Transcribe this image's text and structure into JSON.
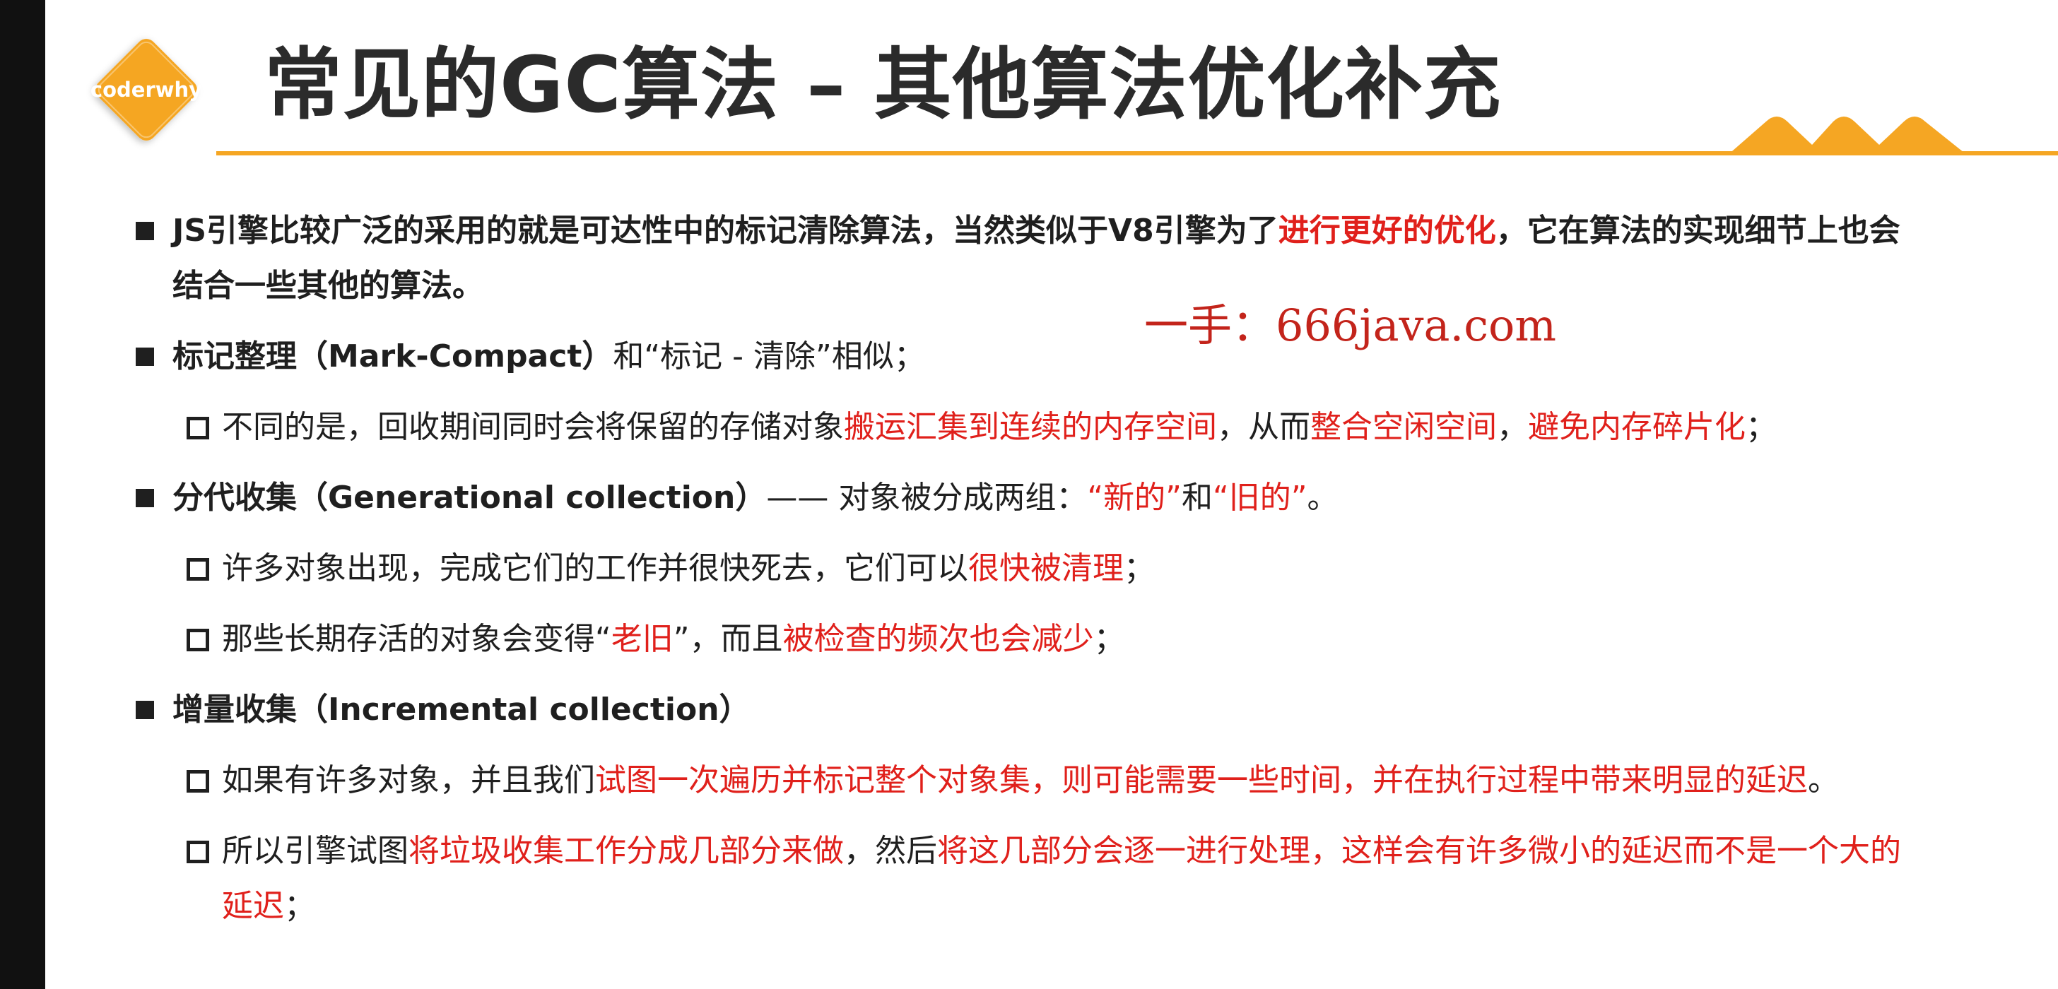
{
  "logo": {
    "text": "coderwhy"
  },
  "title": "常见的GC算法 – 其他算法优化补充",
  "watermark": "一手：666java.com",
  "colors": {
    "accent": "#f5a623",
    "highlight": "#e0201b",
    "text": "#1f1f1f"
  },
  "items": [
    {
      "level": 1,
      "segments": [
        {
          "text": "JS引擎比较广泛的采用的就是可达性中的标记清除算法，当然类似于V8引擎为了"
        },
        {
          "text": "进行更好的优化",
          "red": true
        },
        {
          "text": "，它在算法的实现细节上也会"
        }
      ],
      "segments_line2": [
        {
          "text": "结合一些其他的算法。"
        }
      ]
    },
    {
      "level": 1,
      "segments": [
        {
          "text": "标记整理（Mark-Compact）"
        },
        {
          "text": "和“标记 - 清除”相似；",
          "normal": true
        }
      ]
    },
    {
      "level": 2,
      "segments": [
        {
          "text": "不同的是，回收期间同时会将保留的存储对象"
        },
        {
          "text": "搬运汇集到连续的内存空间",
          "red": true
        },
        {
          "text": "，从而"
        },
        {
          "text": "整合空闲空间",
          "red": true
        },
        {
          "text": "，"
        },
        {
          "text": "避免内存碎片化",
          "red": true
        },
        {
          "text": "；"
        }
      ]
    },
    {
      "level": 1,
      "segments": [
        {
          "text": "分代收集（Generational collection）"
        },
        {
          "text": "—— 对象被分成两组：",
          "normal": true
        },
        {
          "text": "“新的”",
          "red": true,
          "normal": true
        },
        {
          "text": "和",
          "normal": true
        },
        {
          "text": "“旧的”",
          "red": true,
          "normal": true
        },
        {
          "text": "。",
          "normal": true
        }
      ]
    },
    {
      "level": 2,
      "segments": [
        {
          "text": "许多对象出现，完成它们的工作并很快死去，它们可以"
        },
        {
          "text": "很快被清理",
          "red": true
        },
        {
          "text": "；"
        }
      ]
    },
    {
      "level": 2,
      "segments": [
        {
          "text": "那些长期存活的对象会变得“"
        },
        {
          "text": "老旧",
          "red": true
        },
        {
          "text": "”，而且"
        },
        {
          "text": "被检查的频次也会减少",
          "red": true
        },
        {
          "text": "；"
        }
      ]
    },
    {
      "level": 1,
      "segments": [
        {
          "text": "增量收集（Incremental collection）"
        }
      ]
    },
    {
      "level": 2,
      "segments": [
        {
          "text": "如果有许多对象，并且我们"
        },
        {
          "text": "试图一次遍历并标记整个对象集，则可能需要一些时间，并在执行过程中带来明显的延迟",
          "red": true
        },
        {
          "text": "。"
        }
      ]
    },
    {
      "level": 2,
      "segments": [
        {
          "text": "所以引擎试图"
        },
        {
          "text": "将垃圾收集工作分成几部分来做",
          "red": true
        },
        {
          "text": "，然后"
        },
        {
          "text": "将这几部分会逐一进行处理，这样会有许多微小的延迟而不是一个大的",
          "red": true
        }
      ],
      "segments_line2": [
        {
          "text": "延迟",
          "red": true
        },
        {
          "text": "；"
        }
      ]
    }
  ]
}
